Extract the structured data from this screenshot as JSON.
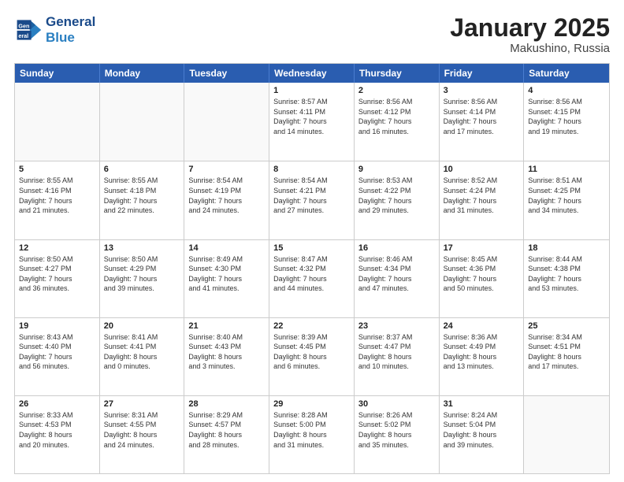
{
  "header": {
    "logo_line1": "General",
    "logo_line2": "Blue",
    "month_title": "January 2025",
    "location": "Makushino, Russia"
  },
  "weekdays": [
    "Sunday",
    "Monday",
    "Tuesday",
    "Wednesday",
    "Thursday",
    "Friday",
    "Saturday"
  ],
  "weeks": [
    [
      {
        "day": "",
        "info": ""
      },
      {
        "day": "",
        "info": ""
      },
      {
        "day": "",
        "info": ""
      },
      {
        "day": "1",
        "info": "Sunrise: 8:57 AM\nSunset: 4:11 PM\nDaylight: 7 hours\nand 14 minutes."
      },
      {
        "day": "2",
        "info": "Sunrise: 8:56 AM\nSunset: 4:12 PM\nDaylight: 7 hours\nand 16 minutes."
      },
      {
        "day": "3",
        "info": "Sunrise: 8:56 AM\nSunset: 4:14 PM\nDaylight: 7 hours\nand 17 minutes."
      },
      {
        "day": "4",
        "info": "Sunrise: 8:56 AM\nSunset: 4:15 PM\nDaylight: 7 hours\nand 19 minutes."
      }
    ],
    [
      {
        "day": "5",
        "info": "Sunrise: 8:55 AM\nSunset: 4:16 PM\nDaylight: 7 hours\nand 21 minutes."
      },
      {
        "day": "6",
        "info": "Sunrise: 8:55 AM\nSunset: 4:18 PM\nDaylight: 7 hours\nand 22 minutes."
      },
      {
        "day": "7",
        "info": "Sunrise: 8:54 AM\nSunset: 4:19 PM\nDaylight: 7 hours\nand 24 minutes."
      },
      {
        "day": "8",
        "info": "Sunrise: 8:54 AM\nSunset: 4:21 PM\nDaylight: 7 hours\nand 27 minutes."
      },
      {
        "day": "9",
        "info": "Sunrise: 8:53 AM\nSunset: 4:22 PM\nDaylight: 7 hours\nand 29 minutes."
      },
      {
        "day": "10",
        "info": "Sunrise: 8:52 AM\nSunset: 4:24 PM\nDaylight: 7 hours\nand 31 minutes."
      },
      {
        "day": "11",
        "info": "Sunrise: 8:51 AM\nSunset: 4:25 PM\nDaylight: 7 hours\nand 34 minutes."
      }
    ],
    [
      {
        "day": "12",
        "info": "Sunrise: 8:50 AM\nSunset: 4:27 PM\nDaylight: 7 hours\nand 36 minutes."
      },
      {
        "day": "13",
        "info": "Sunrise: 8:50 AM\nSunset: 4:29 PM\nDaylight: 7 hours\nand 39 minutes."
      },
      {
        "day": "14",
        "info": "Sunrise: 8:49 AM\nSunset: 4:30 PM\nDaylight: 7 hours\nand 41 minutes."
      },
      {
        "day": "15",
        "info": "Sunrise: 8:47 AM\nSunset: 4:32 PM\nDaylight: 7 hours\nand 44 minutes."
      },
      {
        "day": "16",
        "info": "Sunrise: 8:46 AM\nSunset: 4:34 PM\nDaylight: 7 hours\nand 47 minutes."
      },
      {
        "day": "17",
        "info": "Sunrise: 8:45 AM\nSunset: 4:36 PM\nDaylight: 7 hours\nand 50 minutes."
      },
      {
        "day": "18",
        "info": "Sunrise: 8:44 AM\nSunset: 4:38 PM\nDaylight: 7 hours\nand 53 minutes."
      }
    ],
    [
      {
        "day": "19",
        "info": "Sunrise: 8:43 AM\nSunset: 4:40 PM\nDaylight: 7 hours\nand 56 minutes."
      },
      {
        "day": "20",
        "info": "Sunrise: 8:41 AM\nSunset: 4:41 PM\nDaylight: 8 hours\nand 0 minutes."
      },
      {
        "day": "21",
        "info": "Sunrise: 8:40 AM\nSunset: 4:43 PM\nDaylight: 8 hours\nand 3 minutes."
      },
      {
        "day": "22",
        "info": "Sunrise: 8:39 AM\nSunset: 4:45 PM\nDaylight: 8 hours\nand 6 minutes."
      },
      {
        "day": "23",
        "info": "Sunrise: 8:37 AM\nSunset: 4:47 PM\nDaylight: 8 hours\nand 10 minutes."
      },
      {
        "day": "24",
        "info": "Sunrise: 8:36 AM\nSunset: 4:49 PM\nDaylight: 8 hours\nand 13 minutes."
      },
      {
        "day": "25",
        "info": "Sunrise: 8:34 AM\nSunset: 4:51 PM\nDaylight: 8 hours\nand 17 minutes."
      }
    ],
    [
      {
        "day": "26",
        "info": "Sunrise: 8:33 AM\nSunset: 4:53 PM\nDaylight: 8 hours\nand 20 minutes."
      },
      {
        "day": "27",
        "info": "Sunrise: 8:31 AM\nSunset: 4:55 PM\nDaylight: 8 hours\nand 24 minutes."
      },
      {
        "day": "28",
        "info": "Sunrise: 8:29 AM\nSunset: 4:57 PM\nDaylight: 8 hours\nand 28 minutes."
      },
      {
        "day": "29",
        "info": "Sunrise: 8:28 AM\nSunset: 5:00 PM\nDaylight: 8 hours\nand 31 minutes."
      },
      {
        "day": "30",
        "info": "Sunrise: 8:26 AM\nSunset: 5:02 PM\nDaylight: 8 hours\nand 35 minutes."
      },
      {
        "day": "31",
        "info": "Sunrise: 8:24 AM\nSunset: 5:04 PM\nDaylight: 8 hours\nand 39 minutes."
      },
      {
        "day": "",
        "info": ""
      }
    ]
  ]
}
